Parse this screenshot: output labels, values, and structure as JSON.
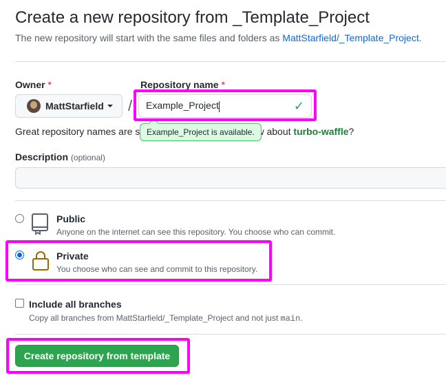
{
  "header": {
    "title": "Create a new repository from _Template_Project",
    "subtitle_prefix": "The new repository will start with the same files and folders as ",
    "subtitle_link": "MattStarfield/_Template_Project",
    "subtitle_suffix": "."
  },
  "owner": {
    "label": "Owner",
    "required_mark": "*",
    "selected": "MattStarfield"
  },
  "separator": "/",
  "repo_name": {
    "label": "Repository name",
    "required_mark": "*",
    "value": "Example_Project",
    "availability": "Example_Project is available."
  },
  "hint": {
    "prefix": "Great repository names are sh",
    "middle": "inspiration? How about ",
    "suggestion": "turbo-waffle",
    "suffix": "?"
  },
  "description": {
    "label": "Description",
    "optional": "(optional)",
    "value": ""
  },
  "visibility": {
    "public": {
      "title": "Public",
      "desc": "Anyone on the internet can see this repository. You choose who can commit."
    },
    "private": {
      "title": "Private",
      "desc": "You choose who can see and commit to this repository."
    },
    "selected": "private"
  },
  "branches": {
    "label": "Include all branches",
    "desc_prefix": "Copy all branches from MattStarfield/_Template_Project and not just ",
    "desc_code": "main",
    "desc_suffix": ".",
    "checked": false
  },
  "submit": {
    "label": "Create repository from template"
  },
  "colors": {
    "accent_link": "#0969da",
    "success": "#2da44e",
    "highlight": "#ff00ff"
  }
}
